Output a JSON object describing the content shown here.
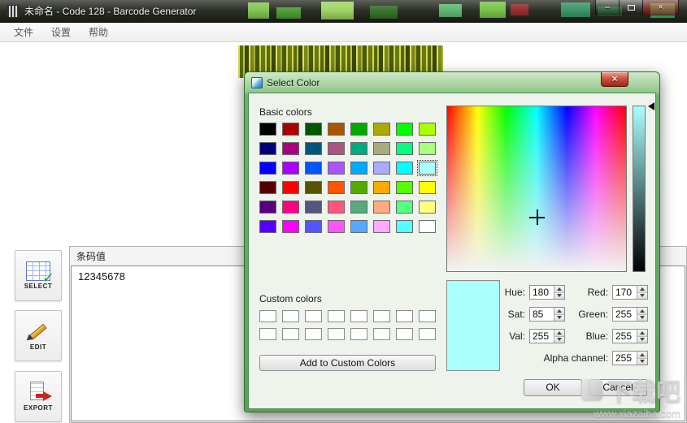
{
  "window": {
    "title": "未命名 - Code 128 - Barcode Generator",
    "menu": [
      "文件",
      "设置",
      "帮助"
    ],
    "controls": {
      "minimize": "–",
      "close": "×"
    }
  },
  "sidebar": {
    "buttons": [
      {
        "label": "SELECT"
      },
      {
        "label": "EDIT"
      },
      {
        "label": "EXPORT"
      }
    ]
  },
  "editor": {
    "group_label": "条码值",
    "value": "12345678"
  },
  "dialog": {
    "title": "Select Color",
    "close_glyph": "×",
    "basic_colors_label": "Basic colors",
    "custom_colors_label": "Custom colors",
    "add_custom_button": "Add to Custom Colors",
    "ok_button": "OK",
    "cancel_button": "Cancel",
    "selected_color": "#aaffff",
    "selected_index": 23,
    "basic_colors": [
      "#000000",
      "#aa0000",
      "#005500",
      "#aa5500",
      "#00aa00",
      "#aaaa00",
      "#00ff00",
      "#aaff00",
      "#00007f",
      "#aa007f",
      "#00557f",
      "#aa557f",
      "#00aa7f",
      "#aaaa7f",
      "#00ff7f",
      "#aaff7f",
      "#0000ff",
      "#aa00ff",
      "#0055ff",
      "#aa55ff",
      "#00aaff",
      "#aaaaff",
      "#00ffff",
      "#aaffff",
      "#550000",
      "#ff0000",
      "#555500",
      "#ff5500",
      "#55aa00",
      "#ffaa00",
      "#55ff00",
      "#ffff00",
      "#55007f",
      "#ff007f",
      "#55557f",
      "#ff557f",
      "#55aa7f",
      "#ffaa7f",
      "#55ff7f",
      "#ffff7f",
      "#5500ff",
      "#ff00ff",
      "#5555ff",
      "#ff55ff",
      "#55aaff",
      "#ffaaff",
      "#55ffff",
      "#ffffff"
    ],
    "custom_colors": [
      "#ffffff",
      "#ffffff",
      "#ffffff",
      "#ffffff",
      "#ffffff",
      "#ffffff",
      "#ffffff",
      "#ffffff",
      "#ffffff",
      "#ffffff",
      "#ffffff",
      "#ffffff",
      "#ffffff",
      "#ffffff",
      "#ffffff",
      "#ffffff"
    ],
    "fields": {
      "hue": {
        "label": "Hue:",
        "value": "180"
      },
      "sat": {
        "label": "Sat:",
        "value": "85"
      },
      "val": {
        "label": "Val:",
        "value": "255"
      },
      "red": {
        "label": "Red:",
        "value": "170"
      },
      "green": {
        "label": "Green:",
        "value": "255"
      },
      "blue": {
        "label": "Blue:",
        "value": "255"
      },
      "alpha": {
        "label": "Alpha channel:",
        "value": "255"
      }
    }
  },
  "watermark": {
    "brand": "下载吧",
    "url": "www.xiazaiba.com"
  }
}
